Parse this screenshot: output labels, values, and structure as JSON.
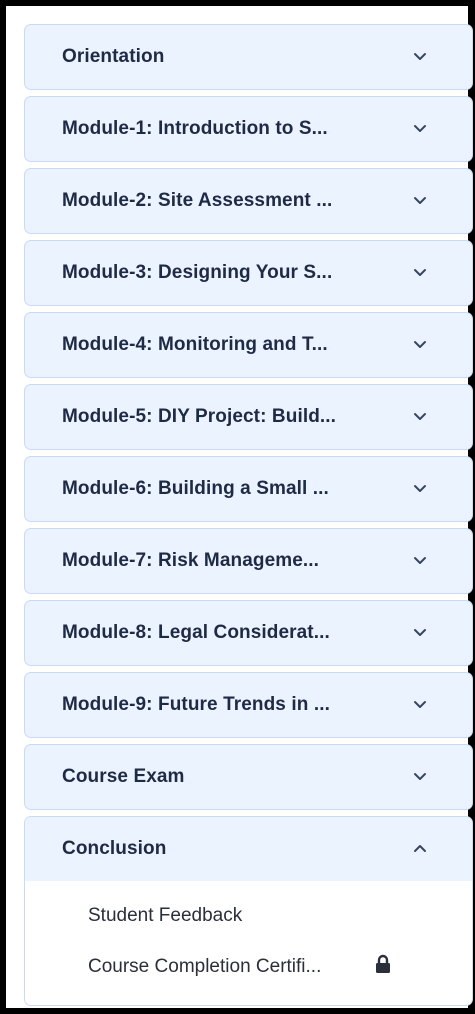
{
  "modules": [
    {
      "title": "Orientation",
      "state": "collapsed",
      "icon": "chevron-down-icon"
    },
    {
      "title": "Module-1: Introduction to S...",
      "state": "collapsed",
      "icon": "chevron-down-icon"
    },
    {
      "title": "Module-2: Site Assessment ...",
      "state": "collapsed",
      "icon": "chevron-down-icon"
    },
    {
      "title": "Module-3: Designing Your S...",
      "state": "collapsed",
      "icon": "chevron-down-icon"
    },
    {
      "title": "Module-4: Monitoring and T...",
      "state": "collapsed",
      "icon": "chevron-down-icon"
    },
    {
      "title": "Module-5: DIY Project: Build...",
      "state": "collapsed",
      "icon": "chevron-down-icon"
    },
    {
      "title": "Module-6: Building a Small ...",
      "state": "collapsed",
      "icon": "chevron-down-icon"
    },
    {
      "title": "Module-7: Risk Manageme...",
      "state": "collapsed",
      "icon": "chevron-down-icon"
    },
    {
      "title": "Module-8: Legal Considerat...",
      "state": "collapsed",
      "icon": "chevron-down-icon"
    },
    {
      "title": "Module-9: Future Trends in ...",
      "state": "collapsed",
      "icon": "chevron-down-icon"
    },
    {
      "title": "Course Exam",
      "state": "collapsed",
      "icon": "chevron-down-icon"
    }
  ],
  "conclusion": {
    "title": "Conclusion",
    "state": "expanded",
    "icon": "chevron-up-icon",
    "items": [
      {
        "label": "Student Feedback",
        "locked": false
      },
      {
        "label": "Course Completion Certifi...",
        "locked": true,
        "icon": "lock-icon"
      }
    ]
  },
  "colors": {
    "header_bg": "#eaf3ff",
    "border": "#c9dbf2",
    "title_text": "#1f2a44",
    "item_text": "#2b2f3a"
  }
}
